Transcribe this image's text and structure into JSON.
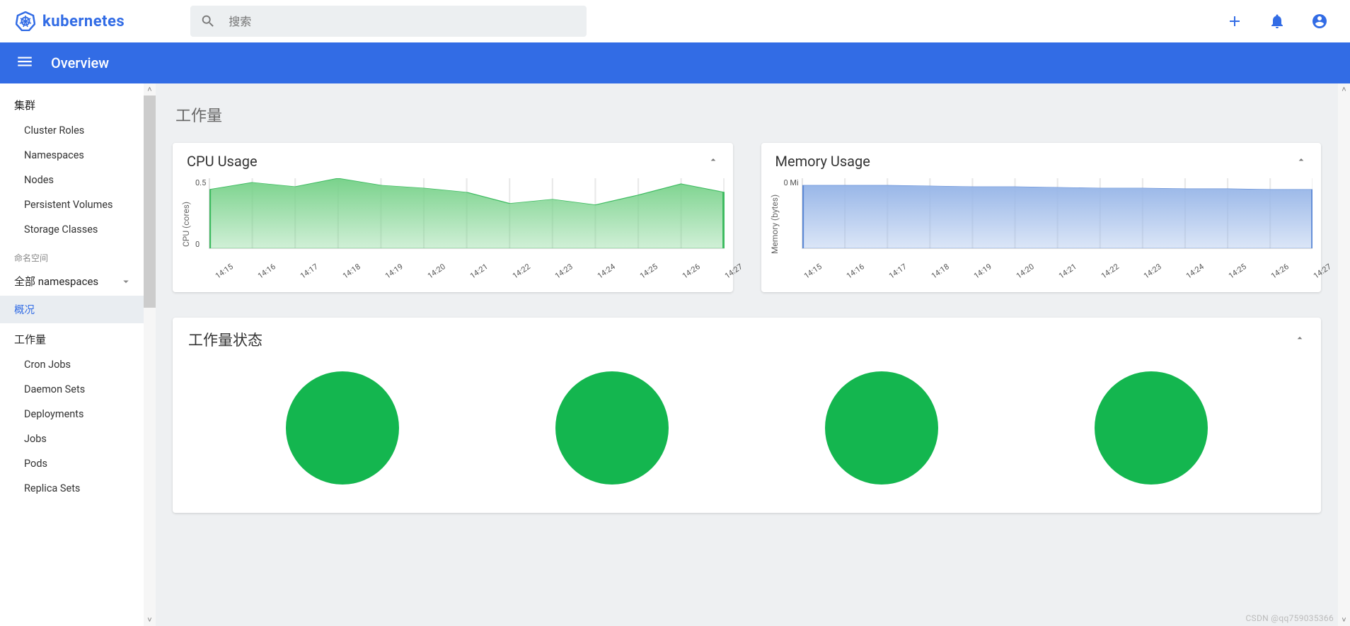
{
  "header": {
    "logo_text": "kubernetes",
    "search_placeholder": "搜索"
  },
  "subheader": {
    "title": "Overview"
  },
  "sidebar": {
    "cluster_section": "集群",
    "cluster_items": [
      "Cluster Roles",
      "Namespaces",
      "Nodes",
      "Persistent Volumes",
      "Storage Classes"
    ],
    "ns_label": "命名空间",
    "ns_selector": "全部 namespaces",
    "overview_item": "概况",
    "workload_section": "工作量",
    "workload_items": [
      "Cron Jobs",
      "Daemon Sets",
      "Deployments",
      "Jobs",
      "Pods",
      "Replica Sets"
    ]
  },
  "content": {
    "section_title": "工作量",
    "status_title": "工作量状态",
    "status_circle_count": 4,
    "status_color": "#14b64f"
  },
  "chart_data": [
    {
      "type": "area",
      "title": "CPU Usage",
      "ylabel": "CPU (cores)",
      "categories": [
        "14:15",
        "14:16",
        "14:17",
        "14:18",
        "14:19",
        "14:20",
        "14:21",
        "14:22",
        "14:23",
        "14:24",
        "14:25",
        "14:26",
        "14:27"
      ],
      "y_ticks": [
        "0.5",
        "0"
      ],
      "ylim": [
        0,
        0.5
      ],
      "values": [
        0.42,
        0.47,
        0.44,
        0.5,
        0.45,
        0.43,
        0.4,
        0.32,
        0.35,
        0.31,
        0.38,
        0.46,
        0.4
      ],
      "fill": "#79d28b",
      "stroke": "#3dbb60"
    },
    {
      "type": "area",
      "title": "Memory Usage",
      "ylabel": "Memory (bytes)",
      "categories": [
        "14:15",
        "14:16",
        "14:17",
        "14:18",
        "14:19",
        "14:20",
        "14:21",
        "14:22",
        "14:23",
        "14:24",
        "14:25",
        "14:26",
        "14:27"
      ],
      "y_ticks": [
        "0 Mi"
      ],
      "ylim": [
        0,
        100
      ],
      "values": [
        90,
        90,
        90,
        89,
        88,
        88,
        87,
        86,
        86,
        85,
        85,
        84,
        84
      ],
      "fill": "#99b7e8",
      "stroke": "#5e8ad6"
    }
  ],
  "watermark": "CSDN @qq759035366"
}
